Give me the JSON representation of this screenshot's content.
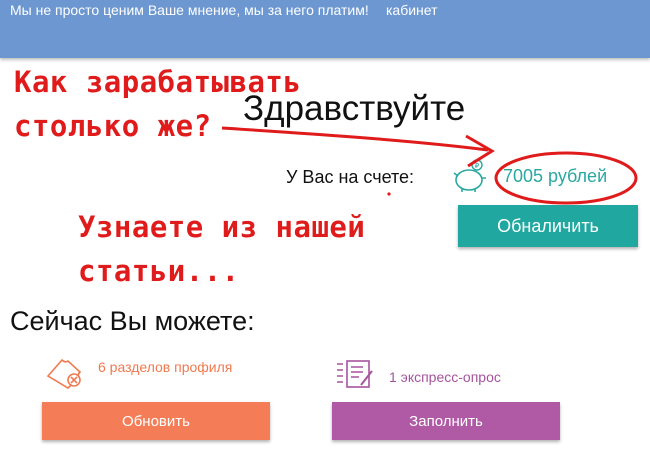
{
  "header": {
    "slogan": "Мы не просто ценим Ваше мнение, мы за него платим!",
    "cabinet_link": "кабинет"
  },
  "promo": {
    "headline": "Как зарабатывать столько же?",
    "subline": "Узнаете из нашей статьи..."
  },
  "account": {
    "greeting": "Здравствуйте",
    "balance_label": "У Вас на счете:",
    "balance_value": "7005 рублей",
    "cashout_label": "Обналичить"
  },
  "tasks": {
    "title": "Сейчас Вы можете:",
    "profile": {
      "label": "6 разделов профиля",
      "button": "Обновить"
    },
    "survey": {
      "label": "1 экспресс-опрос",
      "button": "Заполнить"
    }
  },
  "colors": {
    "header": "#6d97d0",
    "annotation": "#e01b1b",
    "teal": "#20a8a0",
    "orange": "#f47d57",
    "purple": "#b05aa6"
  },
  "icons": {
    "balance": "piggy-bank-icon",
    "profile": "ticket-icon",
    "survey": "survey-list-icon"
  }
}
